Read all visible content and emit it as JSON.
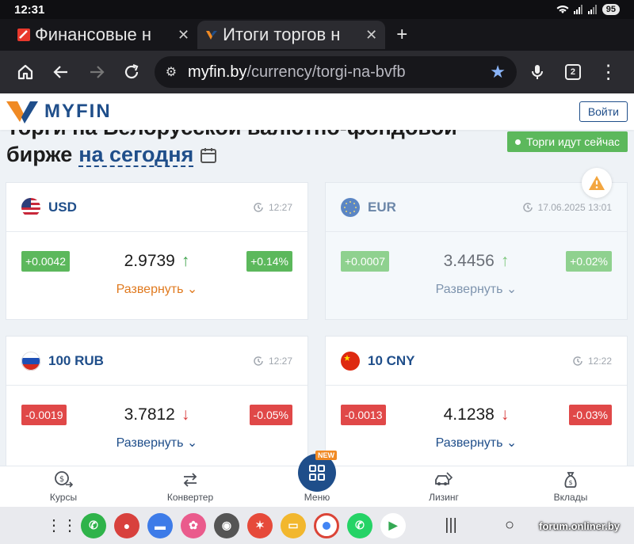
{
  "status_bar": {
    "time": "12:31",
    "battery": "95"
  },
  "tabs": [
    {
      "title": "Финансовые н",
      "active": false
    },
    {
      "title": "Итоги торгов н",
      "active": true
    }
  ],
  "address_bar": {
    "host": "myfin.by",
    "path": "/currency/torgi-na-bvfb",
    "tab_count": "2"
  },
  "site": {
    "logo_text": "MYFIN",
    "login_label": "Войти"
  },
  "heading": {
    "line1": "Торги на Белорусской валютно-фондовой",
    "line2_prefix": "бирже",
    "line2_link": "на сегодня",
    "live_badge": "Торги идут сейчас"
  },
  "cards": [
    {
      "code": "USD",
      "time": "12:27",
      "change": "+0.0042",
      "rate": "2.9739",
      "direction": "up",
      "percent": "+0.14%",
      "expand_label": "Развернуть"
    },
    {
      "code": "EUR",
      "time": "17.06.2025 13:01",
      "change": "+0.0007",
      "rate": "3.4456",
      "direction": "up",
      "percent": "+0.02%",
      "expand_label": "Развернуть"
    },
    {
      "code": "100 RUB",
      "time": "12:27",
      "change": "-0.0019",
      "rate": "3.7812",
      "direction": "down",
      "percent": "-0.05%",
      "expand_label": "Развернуть"
    },
    {
      "code": "10 CNY",
      "time": "12:22",
      "change": "-0.0013",
      "rate": "4.1238",
      "direction": "down",
      "percent": "-0.03%",
      "expand_label": "Развернуть"
    }
  ],
  "bottom_nav": [
    {
      "label": "Курсы",
      "icon": "currency-exchange-icon"
    },
    {
      "label": "Конвертер",
      "icon": "convert-arrows-icon"
    },
    {
      "label": "Меню",
      "icon": "grid-menu-icon",
      "badge": "NEW"
    },
    {
      "label": "Лизинг",
      "icon": "car-leasing-icon"
    },
    {
      "label": "Вклады",
      "icon": "money-bag-icon"
    }
  ],
  "watermark": "forum.onliner.by",
  "colors": {
    "brand_blue": "#1f4e8a",
    "brand_orange": "#f08a24",
    "up_green": "#5cb85c",
    "down_red": "#e04848"
  }
}
